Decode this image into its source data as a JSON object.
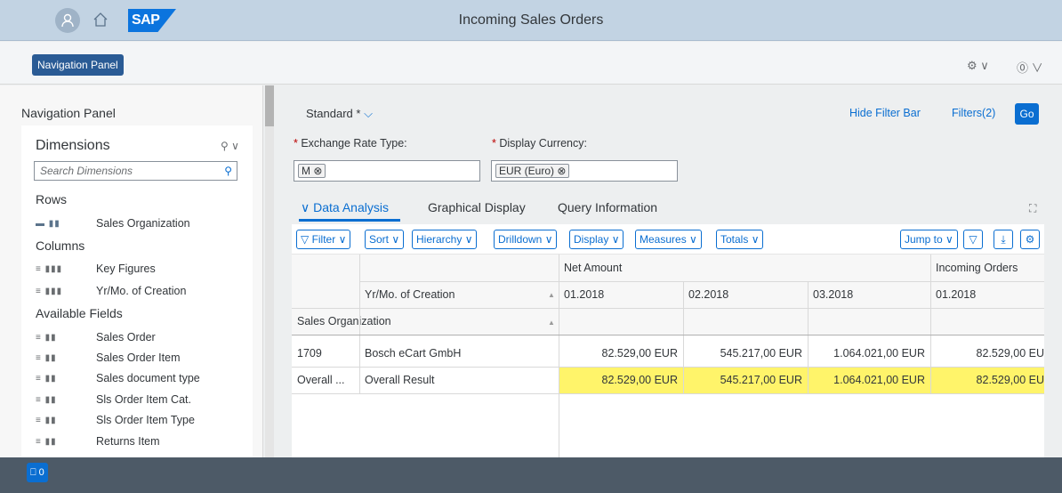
{
  "shell": {
    "title": "Incoming Sales Orders",
    "logo": "SAP",
    "icons": [
      "user-avatar-icon",
      "home-icon"
    ]
  },
  "subheader": {
    "nav_button": "Navigation Panel",
    "settings_icon": "⚙︎∨",
    "help_icon": "?∨"
  },
  "nav_panel": {
    "title": "Navigation Panel",
    "dimensions_title": "Dimensions",
    "search_placeholder": "Search Dimensions",
    "rows_label": "Rows",
    "rows": [
      "Sales Organization"
    ],
    "columns_label": "Columns",
    "columns": [
      "Key Figures",
      "Yr/Mo. of Creation"
    ],
    "available_label": "Available Fields",
    "available": [
      "Sales Order",
      "Sales Order Item",
      "Sales document type",
      "Sls Order Item Cat.",
      "Sls Order Item Type",
      "Returns Item"
    ]
  },
  "filter_bar": {
    "variant": "Standard *",
    "hide_filter_bar": "Hide Filter Bar",
    "filters": "Filters(2)",
    "go": "Go",
    "fields": [
      {
        "label": "Exchange Rate Type:",
        "token": "M ⊗"
      },
      {
        "label": "Display Currency:",
        "token": "EUR (Euro) ⊗"
      }
    ]
  },
  "tabs": [
    "Data Analysis",
    "Graphical Display",
    "Query Information"
  ],
  "toolbar": {
    "left": [
      "Filter",
      "Sort",
      "Hierarchy",
      "Drilldown",
      "Display",
      "Measures",
      "Totals"
    ],
    "jump_to": "Jump to"
  },
  "table": {
    "measure_headers": [
      "Net Amount",
      "Incoming Orders"
    ],
    "dim_col_header": "Yr/Mo. of Creation",
    "row_header": "Sales Organization",
    "periods": [
      "01.2018",
      "02.2018",
      "03.2018",
      "01.2018"
    ],
    "rows": [
      {
        "code": "1709",
        "name": "Bosch eCart GmbH",
        "values": [
          "82.529,00 EUR",
          "545.217,00 EUR",
          "1.064.021,00 EUR",
          "82.529,00 EU"
        ],
        "highlight": false
      },
      {
        "code": "Overall ...",
        "name": "Overall Result",
        "values": [
          "82.529,00 EUR",
          "545.217,00 EUR",
          "1.064.021,00 EUR",
          "82.529,00 EU"
        ],
        "highlight": true
      }
    ]
  },
  "footer": {
    "messages": "0"
  },
  "colors": {
    "accent": "#0a6ed1",
    "highlight": "#fff46a",
    "shell": "#c2d3e3",
    "footer": "#4d5a67"
  }
}
